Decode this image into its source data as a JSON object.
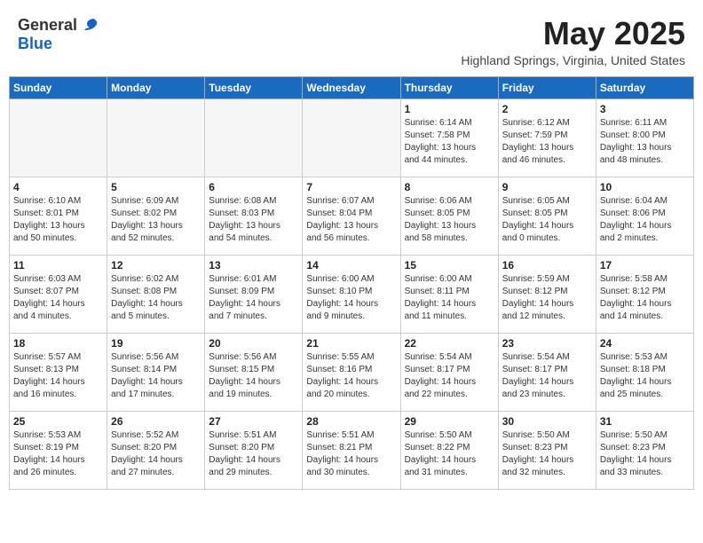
{
  "logo": {
    "general": "General",
    "blue": "Blue"
  },
  "title": {
    "month_year": "May 2025",
    "location": "Highland Springs, Virginia, United States"
  },
  "days_of_week": [
    "Sunday",
    "Monday",
    "Tuesday",
    "Wednesday",
    "Thursday",
    "Friday",
    "Saturday"
  ],
  "weeks": [
    [
      {
        "day": "",
        "info": ""
      },
      {
        "day": "",
        "info": ""
      },
      {
        "day": "",
        "info": ""
      },
      {
        "day": "",
        "info": ""
      },
      {
        "day": "1",
        "info": "Sunrise: 6:14 AM\nSunset: 7:58 PM\nDaylight: 13 hours\nand 44 minutes."
      },
      {
        "day": "2",
        "info": "Sunrise: 6:12 AM\nSunset: 7:59 PM\nDaylight: 13 hours\nand 46 minutes."
      },
      {
        "day": "3",
        "info": "Sunrise: 6:11 AM\nSunset: 8:00 PM\nDaylight: 13 hours\nand 48 minutes."
      }
    ],
    [
      {
        "day": "4",
        "info": "Sunrise: 6:10 AM\nSunset: 8:01 PM\nDaylight: 13 hours\nand 50 minutes."
      },
      {
        "day": "5",
        "info": "Sunrise: 6:09 AM\nSunset: 8:02 PM\nDaylight: 13 hours\nand 52 minutes."
      },
      {
        "day": "6",
        "info": "Sunrise: 6:08 AM\nSunset: 8:03 PM\nDaylight: 13 hours\nand 54 minutes."
      },
      {
        "day": "7",
        "info": "Sunrise: 6:07 AM\nSunset: 8:04 PM\nDaylight: 13 hours\nand 56 minutes."
      },
      {
        "day": "8",
        "info": "Sunrise: 6:06 AM\nSunset: 8:05 PM\nDaylight: 13 hours\nand 58 minutes."
      },
      {
        "day": "9",
        "info": "Sunrise: 6:05 AM\nSunset: 8:05 PM\nDaylight: 14 hours\nand 0 minutes."
      },
      {
        "day": "10",
        "info": "Sunrise: 6:04 AM\nSunset: 8:06 PM\nDaylight: 14 hours\nand 2 minutes."
      }
    ],
    [
      {
        "day": "11",
        "info": "Sunrise: 6:03 AM\nSunset: 8:07 PM\nDaylight: 14 hours\nand 4 minutes."
      },
      {
        "day": "12",
        "info": "Sunrise: 6:02 AM\nSunset: 8:08 PM\nDaylight: 14 hours\nand 5 minutes."
      },
      {
        "day": "13",
        "info": "Sunrise: 6:01 AM\nSunset: 8:09 PM\nDaylight: 14 hours\nand 7 minutes."
      },
      {
        "day": "14",
        "info": "Sunrise: 6:00 AM\nSunset: 8:10 PM\nDaylight: 14 hours\nand 9 minutes."
      },
      {
        "day": "15",
        "info": "Sunrise: 6:00 AM\nSunset: 8:11 PM\nDaylight: 14 hours\nand 11 minutes."
      },
      {
        "day": "16",
        "info": "Sunrise: 5:59 AM\nSunset: 8:12 PM\nDaylight: 14 hours\nand 12 minutes."
      },
      {
        "day": "17",
        "info": "Sunrise: 5:58 AM\nSunset: 8:12 PM\nDaylight: 14 hours\nand 14 minutes."
      }
    ],
    [
      {
        "day": "18",
        "info": "Sunrise: 5:57 AM\nSunset: 8:13 PM\nDaylight: 14 hours\nand 16 minutes."
      },
      {
        "day": "19",
        "info": "Sunrise: 5:56 AM\nSunset: 8:14 PM\nDaylight: 14 hours\nand 17 minutes."
      },
      {
        "day": "20",
        "info": "Sunrise: 5:56 AM\nSunset: 8:15 PM\nDaylight: 14 hours\nand 19 minutes."
      },
      {
        "day": "21",
        "info": "Sunrise: 5:55 AM\nSunset: 8:16 PM\nDaylight: 14 hours\nand 20 minutes."
      },
      {
        "day": "22",
        "info": "Sunrise: 5:54 AM\nSunset: 8:17 PM\nDaylight: 14 hours\nand 22 minutes."
      },
      {
        "day": "23",
        "info": "Sunrise: 5:54 AM\nSunset: 8:17 PM\nDaylight: 14 hours\nand 23 minutes."
      },
      {
        "day": "24",
        "info": "Sunrise: 5:53 AM\nSunset: 8:18 PM\nDaylight: 14 hours\nand 25 minutes."
      }
    ],
    [
      {
        "day": "25",
        "info": "Sunrise: 5:53 AM\nSunset: 8:19 PM\nDaylight: 14 hours\nand 26 minutes."
      },
      {
        "day": "26",
        "info": "Sunrise: 5:52 AM\nSunset: 8:20 PM\nDaylight: 14 hours\nand 27 minutes."
      },
      {
        "day": "27",
        "info": "Sunrise: 5:51 AM\nSunset: 8:20 PM\nDaylight: 14 hours\nand 29 minutes."
      },
      {
        "day": "28",
        "info": "Sunrise: 5:51 AM\nSunset: 8:21 PM\nDaylight: 14 hours\nand 30 minutes."
      },
      {
        "day": "29",
        "info": "Sunrise: 5:50 AM\nSunset: 8:22 PM\nDaylight: 14 hours\nand 31 minutes."
      },
      {
        "day": "30",
        "info": "Sunrise: 5:50 AM\nSunset: 8:23 PM\nDaylight: 14 hours\nand 32 minutes."
      },
      {
        "day": "31",
        "info": "Sunrise: 5:50 AM\nSunset: 8:23 PM\nDaylight: 14 hours\nand 33 minutes."
      }
    ]
  ]
}
